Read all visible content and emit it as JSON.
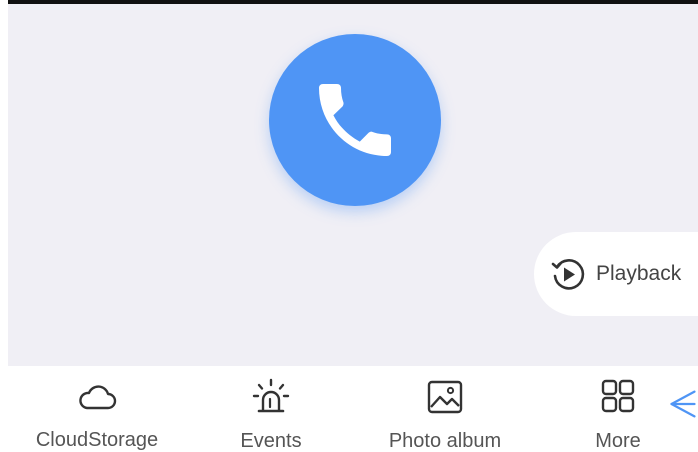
{
  "call": {
    "icon": "phone-icon",
    "color": "#4f95f5"
  },
  "playback": {
    "label": "Playback",
    "icon": "replay-play-icon"
  },
  "bottom_nav": {
    "items": [
      {
        "label": "CloudStorage",
        "icon": "cloud-icon"
      },
      {
        "label": "Events",
        "icon": "alarm-siren-icon"
      },
      {
        "label": "Photo album",
        "icon": "image-icon"
      },
      {
        "label": "More",
        "icon": "grid-icon"
      }
    ],
    "arrow_icon": "chevron-left-icon",
    "arrow_color": "#4f95f5"
  }
}
